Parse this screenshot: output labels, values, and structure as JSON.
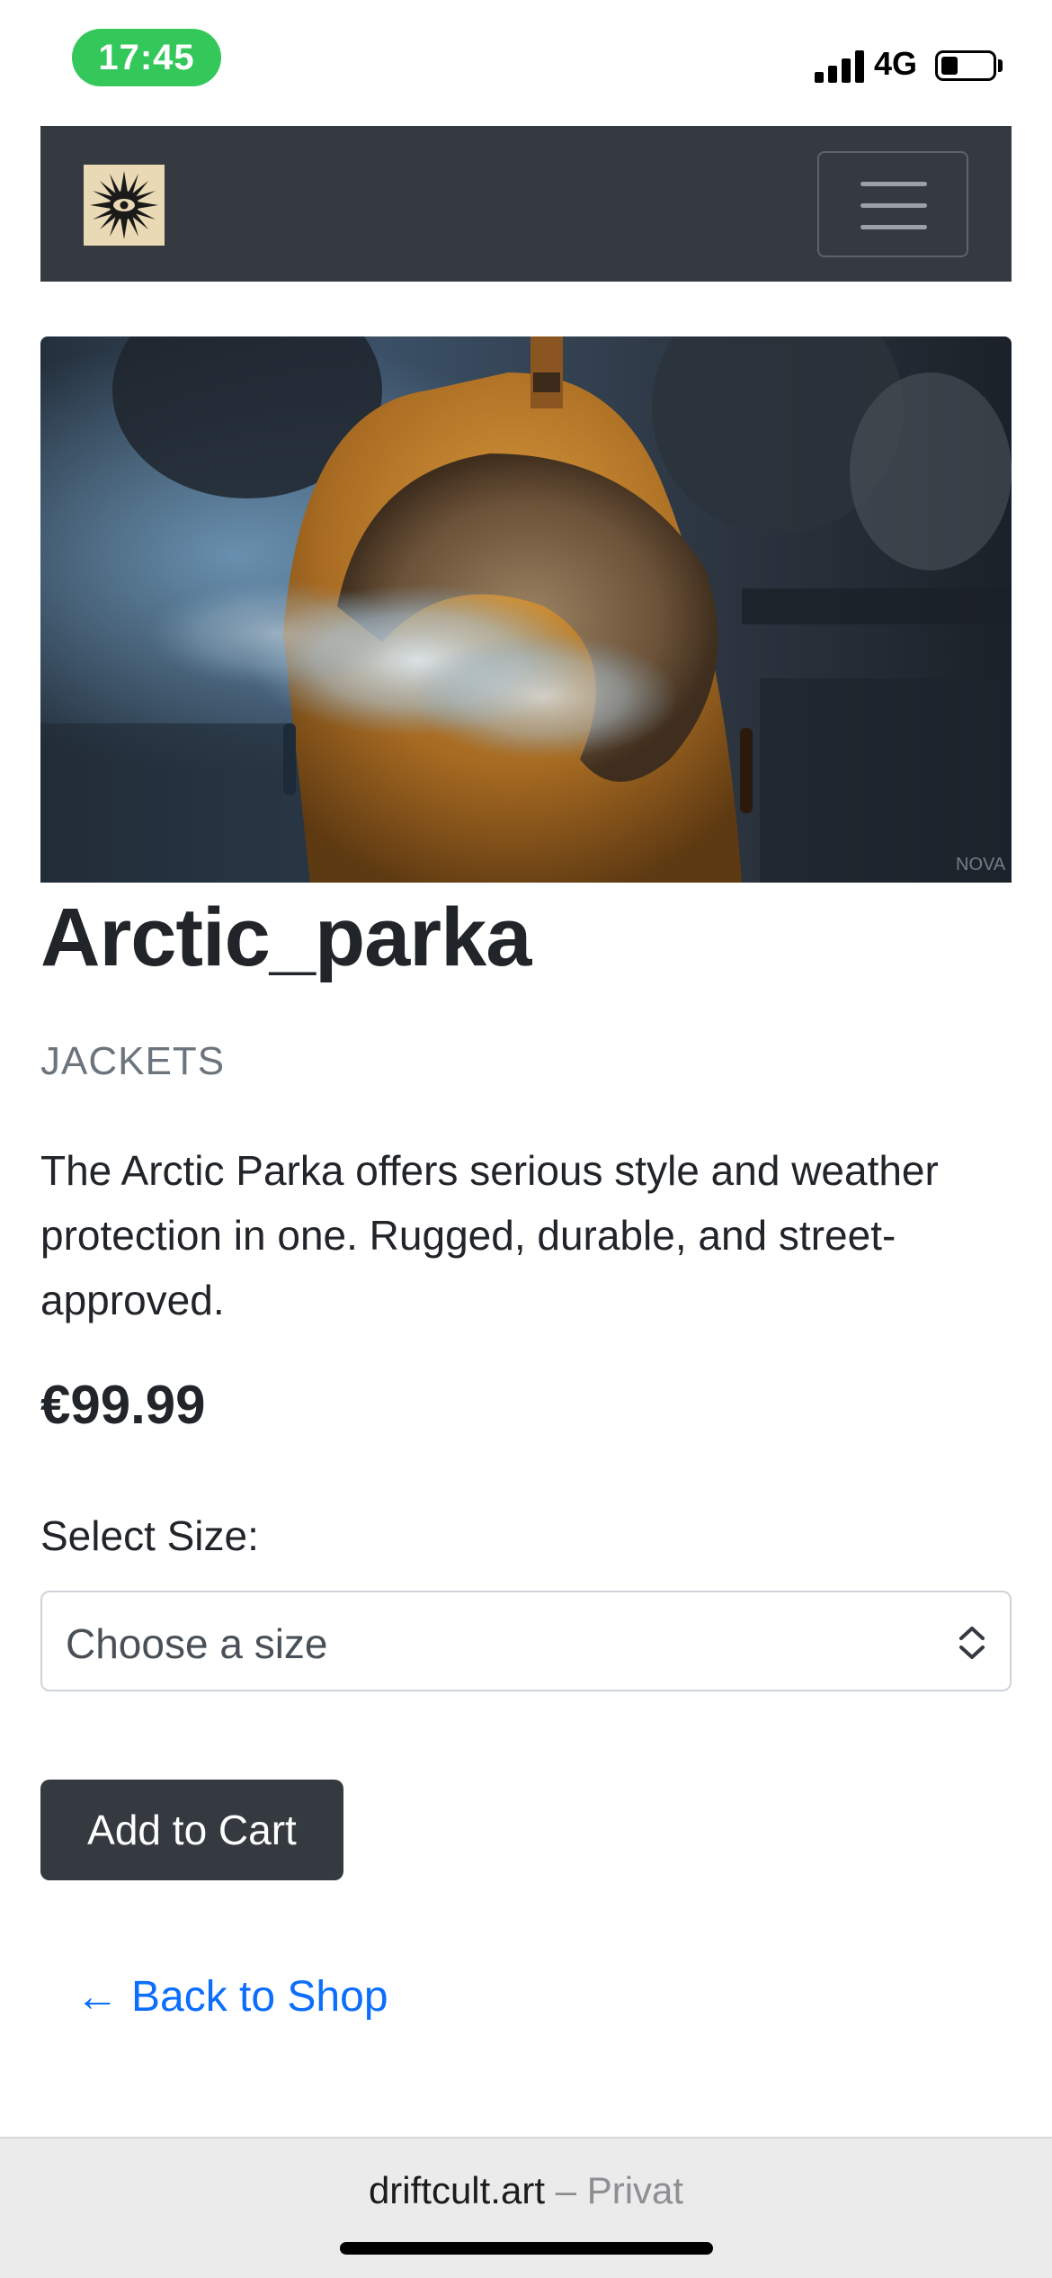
{
  "status_bar": {
    "time": "17:45",
    "network": "4G",
    "icons": [
      "signal-icon",
      "battery-icon"
    ]
  },
  "navbar": {
    "logo_icon": "sun-eye-logo",
    "menu_icon": "hamburger-icon"
  },
  "product": {
    "image_alt": "arctic-parka-photo",
    "title": "Arctic_parka",
    "category": "JACKETS",
    "description": "The Arctic Parka offers serious style and weather protection in one. Rugged, durable, and street-approved.",
    "price": "€99.99",
    "size_label": "Select Size:",
    "size_select_value": "Choose a size",
    "add_to_cart_label": "Add to Cart",
    "back_link_arrow": "←",
    "back_link_label": "Back to Shop",
    "image_watermark": "NOVA"
  },
  "browser": {
    "domain": "driftcult.art",
    "separator": " – ",
    "mode": "Privat"
  },
  "colors": {
    "navbar_bg": "#343a40",
    "link": "#0d6efd",
    "muted": "#6c757d",
    "time_pill": "#34c759"
  }
}
